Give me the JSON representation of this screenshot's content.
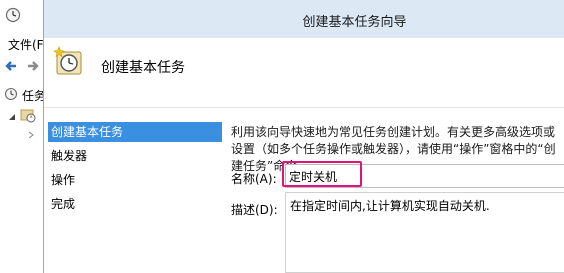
{
  "background_window": {
    "menu_file_label": "文件(F",
    "tree_root_label": "任务"
  },
  "dialog": {
    "title": "创建基本任务向导",
    "header_title": "创建基本任务"
  },
  "steps": [
    {
      "label": "创建基本任务",
      "active": true
    },
    {
      "label": "触发器",
      "active": false
    },
    {
      "label": "操作",
      "active": false
    },
    {
      "label": "完成",
      "active": false
    }
  ],
  "content": {
    "intro_text": "利用该向导快速地为常见任务创建计划。有关更多高级选项或设置（如多个任务操作或触发器），请使用“操作”窗格中的“创建任务”命令。",
    "name_label": "名称(A):",
    "name_value": "定时关机",
    "description_label": "描述(D):",
    "description_value": "在指定时间内,让计算机实现自动关机."
  },
  "colors": {
    "titlebar": "#dce9f5",
    "active_step": "#3b8fe0",
    "highlight": "#e0147a"
  }
}
